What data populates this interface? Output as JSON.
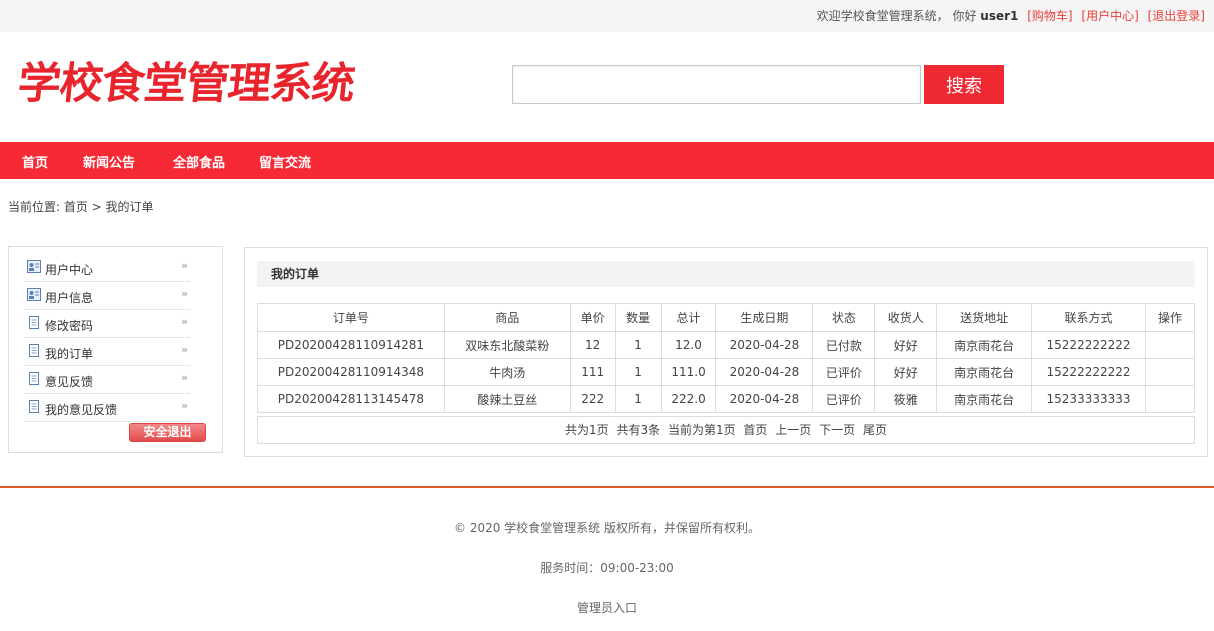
{
  "topbar": {
    "welcome": "欢迎学校食堂管理系统，",
    "greeting": "你好",
    "username": "user1",
    "links": [
      "[购物车]",
      "[用户中心]",
      "[退出登录]"
    ]
  },
  "header": {
    "logo_text": "学校食堂管理系统",
    "search_placeholder": "",
    "search_button": "搜索"
  },
  "nav": {
    "items": [
      "首页",
      "新闻公告",
      "全部食品",
      "留言交流"
    ]
  },
  "breadcrumb": "当前位置: 首页 > 我的订单",
  "sidebar": {
    "items": [
      {
        "label": "用户中心",
        "icon": "user-card-icon"
      },
      {
        "label": "用户信息",
        "icon": "user-card-icon"
      },
      {
        "label": "修改密码",
        "icon": "document-icon"
      },
      {
        "label": "我的订单",
        "icon": "document-icon"
      },
      {
        "label": "意见反馈",
        "icon": "document-icon"
      },
      {
        "label": "我的意见反馈",
        "icon": "document-icon"
      }
    ],
    "arrow": "»",
    "logout_label": "安全退出"
  },
  "orders": {
    "title": "我的订单",
    "columns": [
      "订单号",
      "商品",
      "单价",
      "数量",
      "总计",
      "生成日期",
      "状态",
      "收货人",
      "送货地址",
      "联系方式",
      "操作"
    ],
    "rows": [
      [
        "PD20200428110914281",
        "双味东北酸菜粉",
        "12",
        "1",
        "12.0",
        "2020-04-28",
        "已付款",
        "好好",
        "南京雨花台",
        "15222222222",
        ""
      ],
      [
        "PD20200428110914348",
        "牛肉汤",
        "111",
        "1",
        "111.0",
        "2020-04-28",
        "已评价",
        "好好",
        "南京雨花台",
        "15222222222",
        ""
      ],
      [
        "PD20200428113145478",
        "酸辣土豆丝",
        "222",
        "1",
        "222.0",
        "2020-04-28",
        "已评价",
        "筱雅",
        "南京雨花台",
        "15233333333",
        ""
      ]
    ]
  },
  "pager": {
    "total_pages": "共为1页",
    "total_items": "共有3条",
    "current": "当前为第1页",
    "first": "首页",
    "prev": "上一页",
    "next": "下一页",
    "last": "尾页"
  },
  "footer": {
    "copyright": "© 2020 学校食堂管理系统 版权所有，并保留所有权利。",
    "hours": "服务时间：09:00-23:00",
    "admin_link": "管理员入口"
  },
  "colors": {
    "brand_red": "#f52a35",
    "link_red": "#e8413d",
    "footer_line": "#e05a2a"
  }
}
